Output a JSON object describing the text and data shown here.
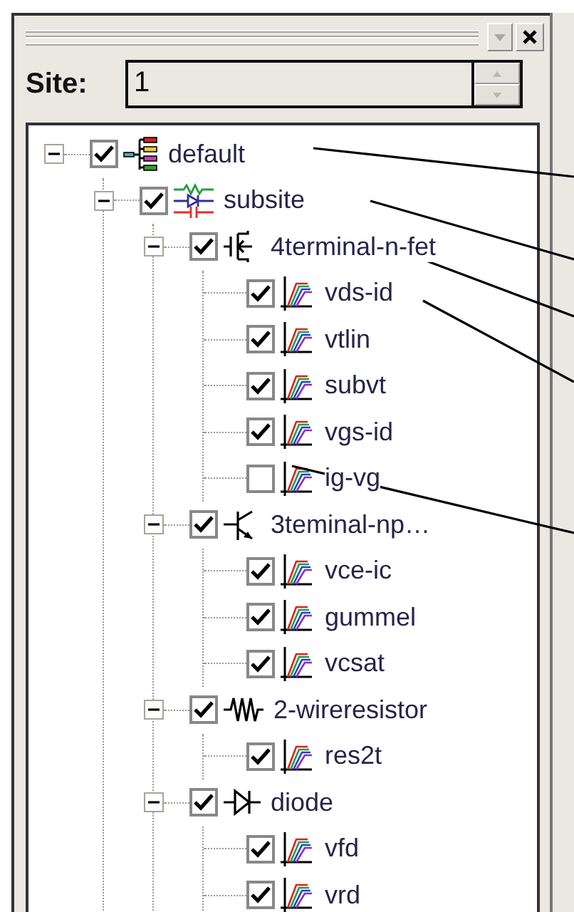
{
  "site": {
    "label": "Site:",
    "value": "1"
  },
  "tree": [
    {
      "label": "default",
      "kind": "site",
      "checked": true,
      "expanded": true,
      "children": [
        {
          "label": "subsite",
          "kind": "subsite",
          "checked": true,
          "expanded": true,
          "children": [
            {
              "label": "4terminal-n-fet",
              "kind": "fet",
              "checked": true,
              "expanded": true,
              "children": [
                {
                  "label": "vds-id",
                  "kind": "sweep",
                  "checked": true
                },
                {
                  "label": "vtlin",
                  "kind": "sweep",
                  "checked": true
                },
                {
                  "label": "subvt",
                  "kind": "sweep",
                  "checked": true
                },
                {
                  "label": "vgs-id",
                  "kind": "sweep",
                  "checked": true
                },
                {
                  "label": "ig-vg",
                  "kind": "sweep",
                  "checked": false
                }
              ]
            },
            {
              "label": "3teminal-np…",
              "kind": "bjt",
              "checked": true,
              "expanded": true,
              "children": [
                {
                  "label": "vce-ic",
                  "kind": "sweep",
                  "checked": true
                },
                {
                  "label": "gummel",
                  "kind": "sweep",
                  "checked": true
                },
                {
                  "label": "vcsat",
                  "kind": "sweep",
                  "checked": true
                }
              ]
            },
            {
              "label": "2-wireresistor",
              "kind": "resistor",
              "checked": true,
              "expanded": true,
              "children": [
                {
                  "label": "res2t",
                  "kind": "sweep",
                  "checked": true
                }
              ]
            },
            {
              "label": "diode",
              "kind": "diode",
              "checked": true,
              "expanded": true,
              "children": [
                {
                  "label": "vfd",
                  "kind": "sweep",
                  "checked": true
                },
                {
                  "label": "vrd",
                  "kind": "sweep",
                  "checked": true
                }
              ]
            }
          ]
        }
      ]
    }
  ]
}
